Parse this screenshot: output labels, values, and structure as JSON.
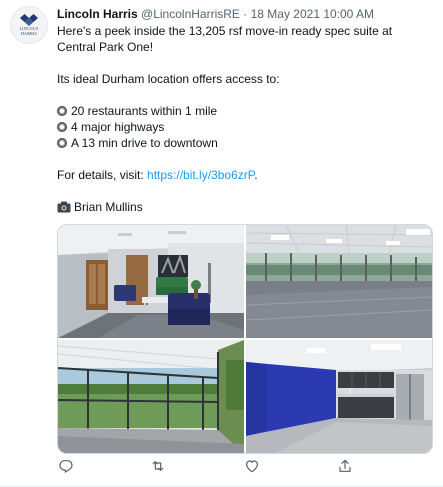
{
  "author": {
    "display_name": "Lincoln Harris",
    "handle": "@LincolnHarrisRE",
    "separator": "·",
    "timestamp": "18 May 2021 10:00 AM",
    "avatar_text_line1": "LINCOLN",
    "avatar_text_line2": "HARRIS"
  },
  "tweet": {
    "line1": "Here's a peek inside the 13,205 rsf move-in ready spec suite at",
    "line2": "Central Park One!",
    "intro": "Its ideal Durham location offers access to:",
    "bullets": [
      "20 restaurants within 1 mile",
      "4 major highways",
      "A 13 min drive to downtown"
    ],
    "details_prefix": "For details, visit: ",
    "link_text": "https://bit.ly/3bo6zrP",
    "details_suffix": ".",
    "credit": "Brian Mullins"
  },
  "media": [
    {
      "alt": "lobby-with-blue-chairs"
    },
    {
      "alt": "open-office-floor"
    },
    {
      "alt": "glass-wall-corner"
    },
    {
      "alt": "break-room-kitchen"
    }
  ],
  "icons": {
    "reply": "reply-icon",
    "retweet": "retweet-icon",
    "like": "like-icon",
    "share": "share-icon",
    "bullet": "radio-button-icon",
    "camera": "camera-icon"
  },
  "colors": {
    "link": "#1d9bf0",
    "secondary_text": "#536471",
    "accent_blue": "#2b3ab0"
  }
}
